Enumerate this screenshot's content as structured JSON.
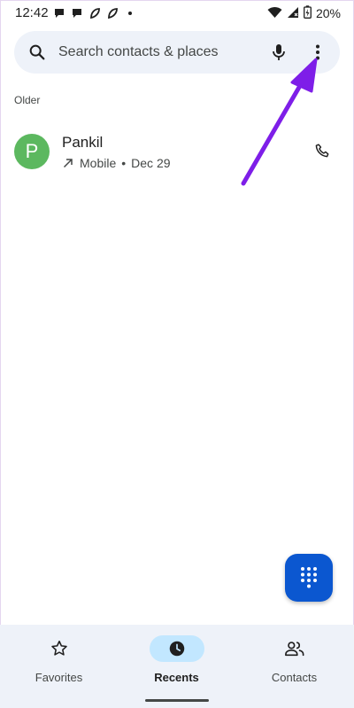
{
  "status_bar": {
    "time": "12:42",
    "battery": "20%",
    "icons": [
      "chat-bubble-icon",
      "chat-bubble-icon",
      "leaf-icon",
      "leaf-icon",
      "dot-icon",
      "wifi-icon",
      "signal-icon",
      "battery-icon"
    ]
  },
  "search": {
    "placeholder": "Search contacts & places"
  },
  "recents": {
    "section_label": "Older",
    "calls": [
      {
        "initial": "P",
        "name": "Pankil",
        "type": "Mobile",
        "date": "Dec 29",
        "direction": "outgoing"
      }
    ]
  },
  "bottom_nav": {
    "items": [
      {
        "label": "Favorites",
        "icon": "star-icon",
        "active": false
      },
      {
        "label": "Recents",
        "icon": "clock-icon",
        "active": true
      },
      {
        "label": "Contacts",
        "icon": "people-icon",
        "active": false
      }
    ]
  },
  "colors": {
    "accent": "#0b57d0",
    "avatar": "#5cb85f",
    "annotation": "#7e1ee8",
    "surface": "#eef2f9",
    "active_pill": "#c2e7ff"
  }
}
